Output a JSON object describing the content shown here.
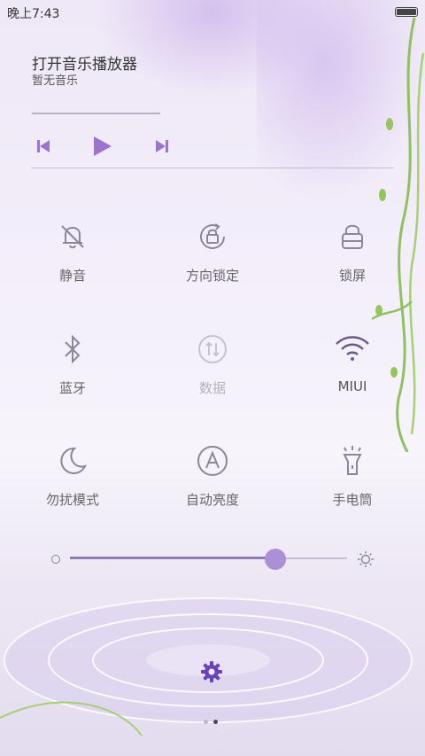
{
  "status_bar": {
    "time": "晚上7:43"
  },
  "music": {
    "title": "打开音乐播放器",
    "subtitle": "暂无音乐",
    "progress_fraction": 0.0
  },
  "toggles": [
    {
      "label": "静音",
      "icon": "mute-bell-icon",
      "state": "off"
    },
    {
      "label": "方向锁定",
      "icon": "rotation-lock-icon",
      "state": "off"
    },
    {
      "label": "锁屏",
      "icon": "lock-icon",
      "state": "off"
    },
    {
      "label": "蓝牙",
      "icon": "bluetooth-icon",
      "state": "off"
    },
    {
      "label": "数据",
      "icon": "mobile-data-icon",
      "state": "disabled"
    },
    {
      "label": "MIUI",
      "icon": "wifi-icon",
      "state": "on"
    },
    {
      "label": "勿扰模式",
      "icon": "moon-icon",
      "state": "off"
    },
    {
      "label": "自动亮度",
      "icon": "auto-brightness-icon",
      "state": "off"
    },
    {
      "label": "手电筒",
      "icon": "flashlight-icon",
      "state": "off"
    }
  ],
  "brightness": {
    "level_fraction": 0.74
  },
  "pager": {
    "pages": 2,
    "current": 2
  },
  "colors": {
    "accent": "#9b74d0",
    "active_icon": "#6a5b8a",
    "inactive_icon": "#8d869a"
  }
}
